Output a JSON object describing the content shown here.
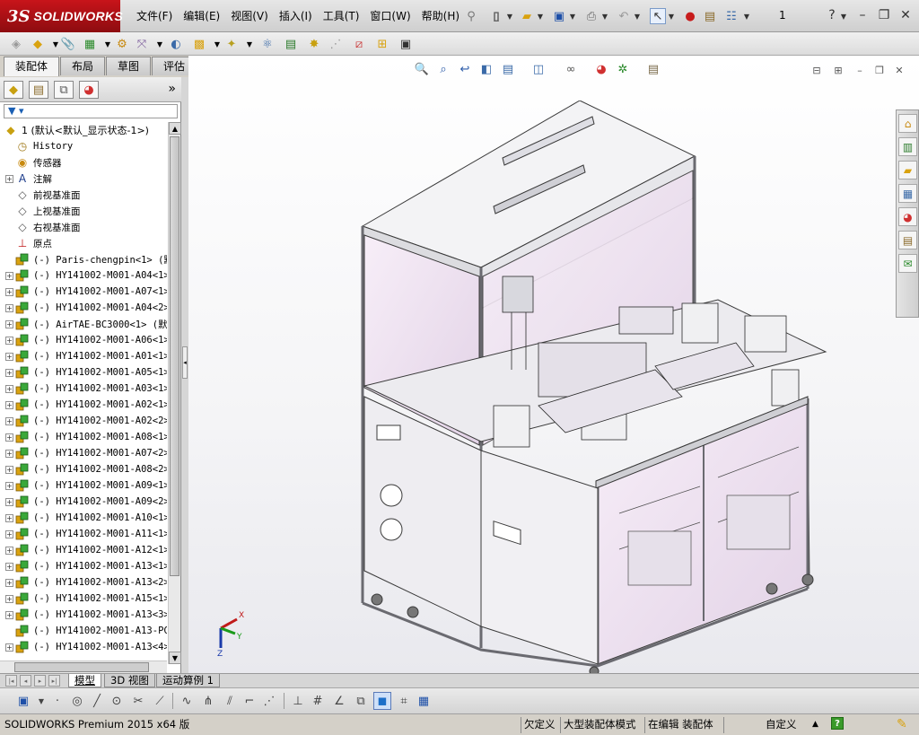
{
  "app": {
    "logo_ds": "3S",
    "logo_name": "SOLIDWORKS",
    "document_number": "1",
    "brand_color": "#b3131a"
  },
  "menubar": {
    "items": [
      "文件(F)",
      "编辑(E)",
      "视图(V)",
      "插入(I)",
      "工具(T)",
      "窗口(W)",
      "帮助(H)"
    ],
    "pin_icon": "pin-icon"
  },
  "standard_toolbar": {
    "icons": [
      "new-document-icon",
      "open-icon",
      "save-icon",
      "print-icon",
      "undo-icon",
      "select-icon",
      "rebuild-icon",
      "file-properties-icon",
      "options-icon"
    ]
  },
  "window_controls": [
    "help-icon",
    "minimize-icon",
    "restore-icon",
    "close-icon"
  ],
  "command_toolbar": {
    "icons": [
      "edit-component-icon",
      "insert-components-icon",
      "mate-icon",
      "component-pattern-icon",
      "smart-fasteners-icon",
      "move-component-icon",
      "show-hidden-icon",
      "assembly-features-icon",
      "reference-geometry-icon",
      "new-motion-study-icon",
      "bill-of-materials-icon",
      "exploded-view-icon",
      "explode-line-sketch-icon",
      "interference-detection-icon",
      "clearance-verification-icon",
      "hole-alignment-icon",
      "measure-icon"
    ]
  },
  "command_tabs": [
    {
      "label": "装配体",
      "active": true
    },
    {
      "label": "布局",
      "active": false
    },
    {
      "label": "草图",
      "active": false
    },
    {
      "label": "评估",
      "active": false
    }
  ],
  "featuremanager": {
    "tab_icons": [
      "featuremanager-icon",
      "propertymanager-icon",
      "configurationmanager-icon",
      "appearance-icon"
    ],
    "more_label": "»",
    "filter_icon": "filter-icon",
    "root": {
      "label": "1  (默认<默认_显示状态-1>)"
    },
    "fixed_items": [
      {
        "label": "History",
        "icon": "history-icon",
        "expandable": false
      },
      {
        "label": "传感器",
        "icon": "sensor-icon",
        "expandable": false
      },
      {
        "label": "注解",
        "icon": "annotations-icon",
        "expandable": true
      },
      {
        "label": "前视基准面",
        "icon": "plane-icon",
        "expandable": false
      },
      {
        "label": "上视基准面",
        "icon": "plane-icon",
        "expandable": false
      },
      {
        "label": "右视基准面",
        "icon": "plane-icon",
        "expandable": false
      },
      {
        "label": "原点",
        "icon": "origin-icon",
        "expandable": false
      }
    ],
    "components": [
      {
        "label": "(-) Paris-chengpin<1> (默",
        "expandable": false
      },
      {
        "label": "(-) HY141002-M001-A04<1>",
        "expandable": true
      },
      {
        "label": "(-) HY141002-M001-A07<1>",
        "expandable": true
      },
      {
        "label": "(-) HY141002-M001-A04<2>",
        "expandable": true
      },
      {
        "label": "(-) AirTAE-BC3000<1> (默",
        "expandable": true
      },
      {
        "label": "(-) HY141002-M001-A06<1>",
        "expandable": true
      },
      {
        "label": "(-) HY141002-M001-A01<1>",
        "expandable": true
      },
      {
        "label": "(-) HY141002-M001-A05<1>",
        "expandable": true
      },
      {
        "label": "(-) HY141002-M001-A03<1>",
        "expandable": true
      },
      {
        "label": "(-) HY141002-M001-A02<1>",
        "expandable": true
      },
      {
        "label": "(-) HY141002-M001-A02<2>",
        "expandable": true
      },
      {
        "label": "(-) HY141002-M001-A08<1>",
        "expandable": true
      },
      {
        "label": "(-) HY141002-M001-A07<2>",
        "expandable": true
      },
      {
        "label": "(-) HY141002-M001-A08<2>",
        "expandable": true
      },
      {
        "label": "(-) HY141002-M001-A09<1>",
        "expandable": true
      },
      {
        "label": "(-) HY141002-M001-A09<2>",
        "expandable": true
      },
      {
        "label": "(-) HY141002-M001-A10<1>",
        "expandable": true
      },
      {
        "label": "(-) HY141002-M001-A11<1>",
        "expandable": true
      },
      {
        "label": "(-) HY141002-M001-A12<1>",
        "expandable": true
      },
      {
        "label": "(-) HY141002-M001-A13<1>",
        "expandable": true
      },
      {
        "label": "(-) HY141002-M001-A13<2>",
        "expandable": true
      },
      {
        "label": "(-) HY141002-M001-A15<1>",
        "expandable": true
      },
      {
        "label": "(-) HY141002-M001-A13<3>",
        "expandable": true
      },
      {
        "label": "(-) HY141002-M001-A13-PC",
        "expandable": false
      },
      {
        "label": "(-) HY141002-M001-A13<4>",
        "expandable": true
      }
    ]
  },
  "heads_up_toolbar": {
    "icons": [
      "zoom-to-fit-icon",
      "zoom-to-area-icon",
      "previous-view-icon",
      "section-view-icon",
      "dynamic-annotation-icon",
      "view-orientation-icon",
      "display-style-icon",
      "hide-show-items-icon",
      "edit-appearance-icon",
      "apply-scene-icon",
      "view-settings-icon"
    ]
  },
  "viewport_controls": [
    "tile-horizontal-icon",
    "tile-vertical-icon",
    "minimize-view-icon",
    "maximize-view-icon",
    "close-view-icon"
  ],
  "task_pane": {
    "icons": [
      "solidworks-resources-icon",
      "design-library-icon",
      "file-explorer-icon",
      "view-palette-icon",
      "appearances-scenes-icon",
      "custom-properties-icon",
      "solidworks-forum-icon"
    ]
  },
  "triad": {
    "x": "X",
    "y": "Y",
    "z": "Z"
  },
  "bottom_tabs": [
    {
      "label": "模型",
      "active": true
    },
    {
      "label": "3D 视图",
      "active": false
    },
    {
      "label": "运动算例 1",
      "active": false
    }
  ],
  "sketch_toolbar": {
    "icons": [
      "save-icon",
      "point-icon",
      "circle-icon",
      "line-icon",
      "smart-dimension-icon",
      "trim-icon",
      "centerline-icon",
      "spline-icon",
      "mirror-icon",
      "offset-icon",
      "corner-rectangle-icon",
      "construction-icon",
      "grid-icon",
      "angle-icon",
      "view-cube-icon",
      "shaded-view-icon",
      "camera-icon",
      "table-icon"
    ]
  },
  "statusbar": {
    "product": "SOLIDWORKS Premium 2015 x64 版",
    "underdefined": "欠定义",
    "mode": "大型装配体模式",
    "editing": "在编辑 装配体",
    "custom": "自定义",
    "help_label": "?"
  }
}
